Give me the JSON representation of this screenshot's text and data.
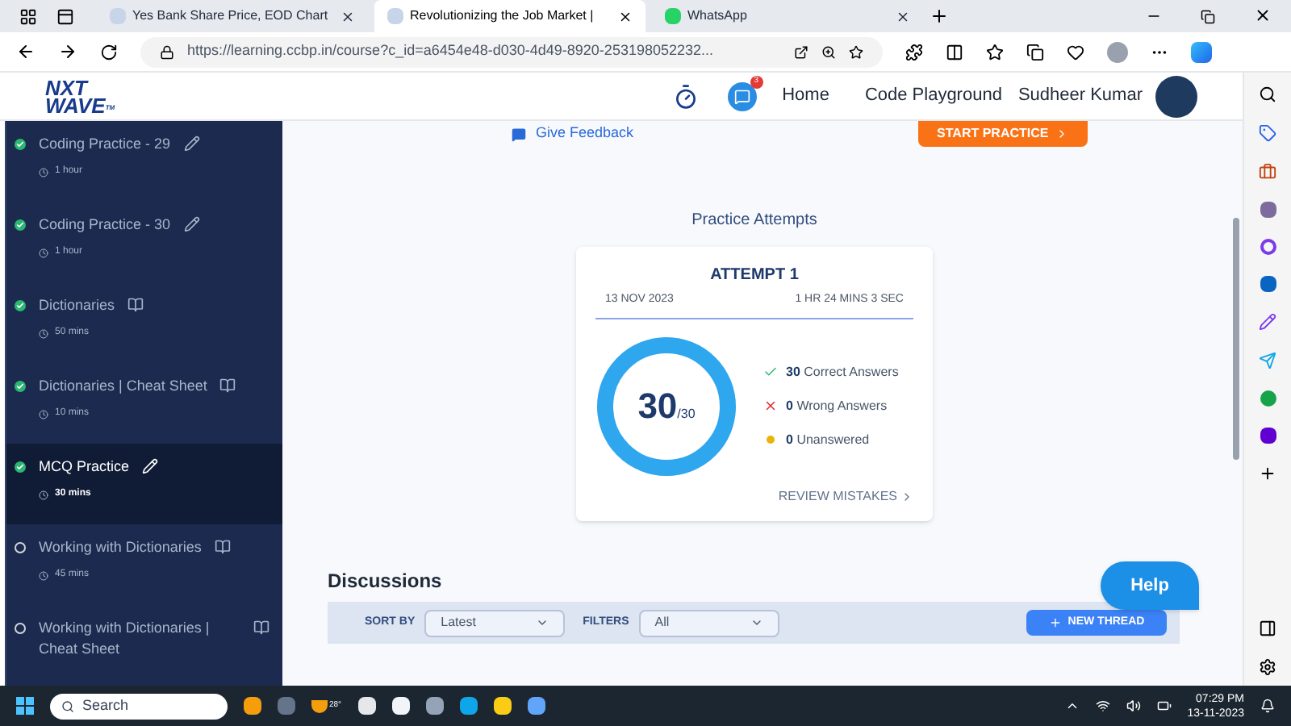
{
  "browser": {
    "tabs": [
      {
        "title": "Yes Bank Share Price, EOD Chart",
        "selected": false
      },
      {
        "title": "Revolutionizing the Job Market |",
        "selected": true
      },
      {
        "title": "WhatsApp",
        "selected": false
      }
    ],
    "url": "https://learning.ccbp.in/course?c_id=a6454e48-d030-4d49-8920-253198052232..."
  },
  "header": {
    "logo_top": "NXT",
    "logo_bottom": "WAVE",
    "logo_mark": "TM",
    "notification_count": "3",
    "nav": [
      "Home",
      "Code Playground"
    ],
    "user": "Sudheer Kumar"
  },
  "sidebar": {
    "items": [
      {
        "title": "Coding Practice - 29",
        "duration": "1 hour",
        "kind": "practice",
        "completed": true,
        "selected": false
      },
      {
        "title": "Coding Practice - 30",
        "duration": "1 hour",
        "kind": "practice",
        "completed": true,
        "selected": false
      },
      {
        "title": "Dictionaries",
        "duration": "50 mins",
        "kind": "reading",
        "completed": true,
        "selected": false
      },
      {
        "title": "Dictionaries | Cheat Sheet",
        "duration": "10 mins",
        "kind": "reading",
        "completed": true,
        "selected": false
      },
      {
        "title": "MCQ Practice",
        "duration": "30 mins",
        "kind": "practice",
        "completed": true,
        "selected": true
      },
      {
        "title": "Working with Dictionaries",
        "duration": "45 mins",
        "kind": "reading",
        "completed": false,
        "selected": false
      },
      {
        "title": "Working with Dictionaries | Cheat Sheet",
        "kind": "reading",
        "completed": false,
        "selected": false
      }
    ]
  },
  "give_feedback": "Give Feedback",
  "start_practice": "START PRACTICE",
  "attempts": {
    "title": "Practice Attempts",
    "card": {
      "title": "ATTEMPT 1",
      "date": "13 NOV 2023",
      "duration": "1 HR 24 MINS 3 SEC",
      "score": "30",
      "total": "/30",
      "level": 1,
      "stats": [
        {
          "kind": "correct",
          "count": "30",
          "label": "Correct Answers"
        },
        {
          "kind": "wrong",
          "count": "0",
          "label": "Wrong Answers"
        },
        {
          "kind": "unanswered",
          "count": "0",
          "label": "Unanswered"
        }
      ],
      "review": "REVIEW MISTAKES"
    }
  },
  "discussions": {
    "title": "Discussions",
    "sort_label": "SORT BY",
    "sort_value": "Latest",
    "filter_label": "FILTERS",
    "filter_value": "All",
    "new_thread": "NEW THREAD"
  },
  "help": "Help",
  "taskbar": {
    "search_placeholder": "Search",
    "temperature": "28°",
    "time": "07:29 PM",
    "date": "13-11-2023"
  }
}
